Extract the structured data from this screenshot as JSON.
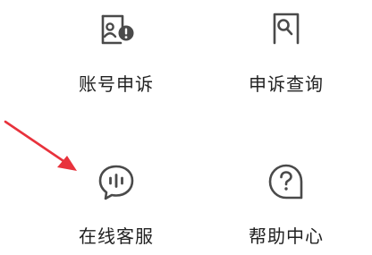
{
  "menu": {
    "items": [
      {
        "label": "账号申诉",
        "icon": "account-appeal-icon"
      },
      {
        "label": "申诉查询",
        "icon": "appeal-query-icon"
      },
      {
        "label": "在线客服",
        "icon": "online-service-icon"
      },
      {
        "label": "帮助中心",
        "icon": "help-center-icon"
      }
    ]
  },
  "colors": {
    "icon": "#4a4a4a",
    "text": "#222222",
    "arrow": "#e8323c"
  }
}
